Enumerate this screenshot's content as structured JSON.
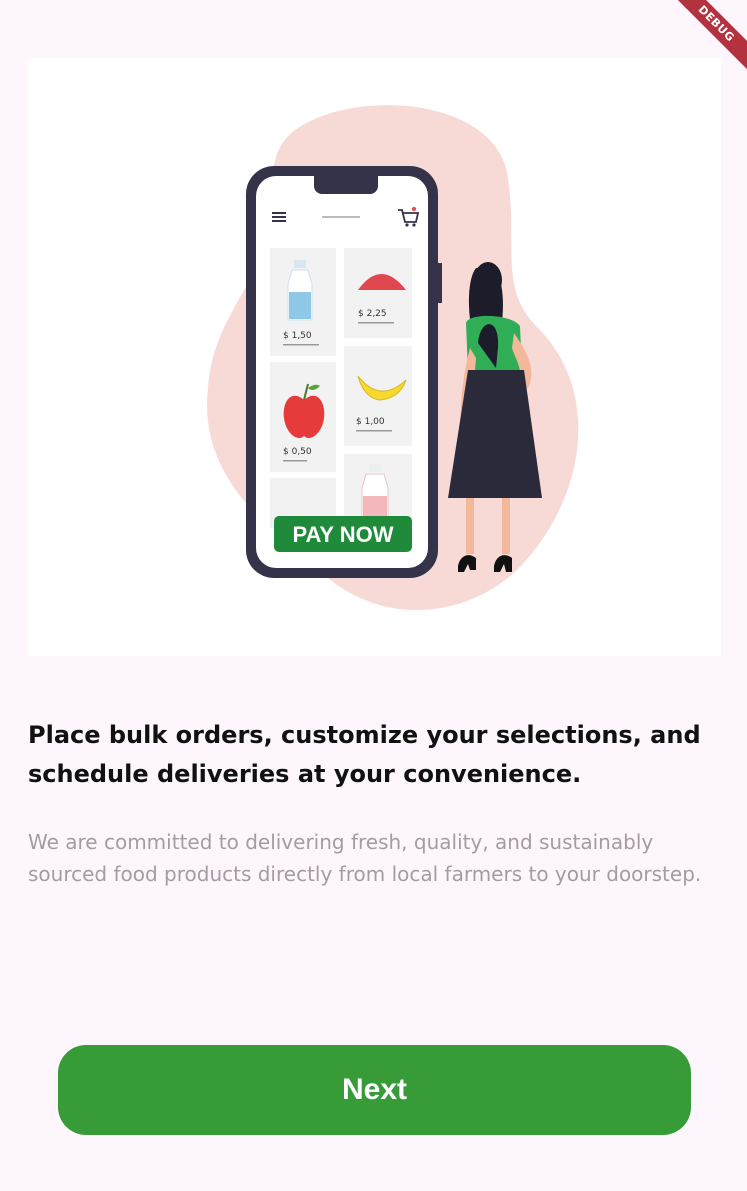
{
  "debug_banner": {
    "label": "DEBUG"
  },
  "onboarding": {
    "illustration": {
      "icon": "shopping-phone-illustration",
      "pay_button_label": "PAY NOW",
      "prices": [
        "$ 1,50",
        "$ 2,25",
        "$ 0,50",
        "$ 1,00"
      ]
    },
    "headline": "Place bulk orders, customize your selections, and schedule deliveries at your convenience.",
    "description": "We are committed to delivering fresh, quality, and sustainably sourced food products directly from local farmers to your doorstep.",
    "next_label": "Next"
  },
  "colors": {
    "background": "#fdf6fc",
    "primary_button": "#379c38",
    "headline": "#111111",
    "description": "#a39ca3"
  }
}
